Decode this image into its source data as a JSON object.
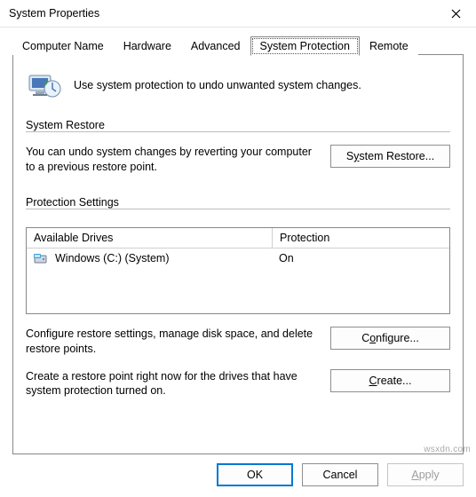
{
  "window": {
    "title": "System Properties"
  },
  "tabs": {
    "t0": "Computer Name",
    "t1": "Hardware",
    "t2": "Advanced",
    "t3": "System Protection",
    "t4": "Remote",
    "active_index": 3
  },
  "intro": {
    "text": "Use system protection to undo unwanted system changes."
  },
  "system_restore": {
    "legend": "System Restore",
    "desc": "You can undo system changes by reverting your computer to a previous restore point.",
    "button_prefix": "S",
    "button_mnemonic": "y",
    "button_suffix": "stem Restore..."
  },
  "protection_settings": {
    "legend": "Protection Settings",
    "header_drive": "Available Drives",
    "header_protection": "Protection",
    "rows": [
      {
        "drive": "Windows (C:) (System)",
        "protection": "On"
      }
    ],
    "configure_desc": "Configure restore settings, manage disk space, and delete restore points.",
    "configure_prefix": "C",
    "configure_mnemonic": "o",
    "configure_suffix": "nfigure...",
    "create_desc": "Create a restore point right now for the drives that have system protection turned on.",
    "create_prefix": "",
    "create_mnemonic": "C",
    "create_suffix": "reate..."
  },
  "buttons": {
    "ok": "OK",
    "cancel": "Cancel",
    "apply_prefix": "",
    "apply_mnemonic": "A",
    "apply_suffix": "pply"
  },
  "watermark": "wsxdn.com"
}
